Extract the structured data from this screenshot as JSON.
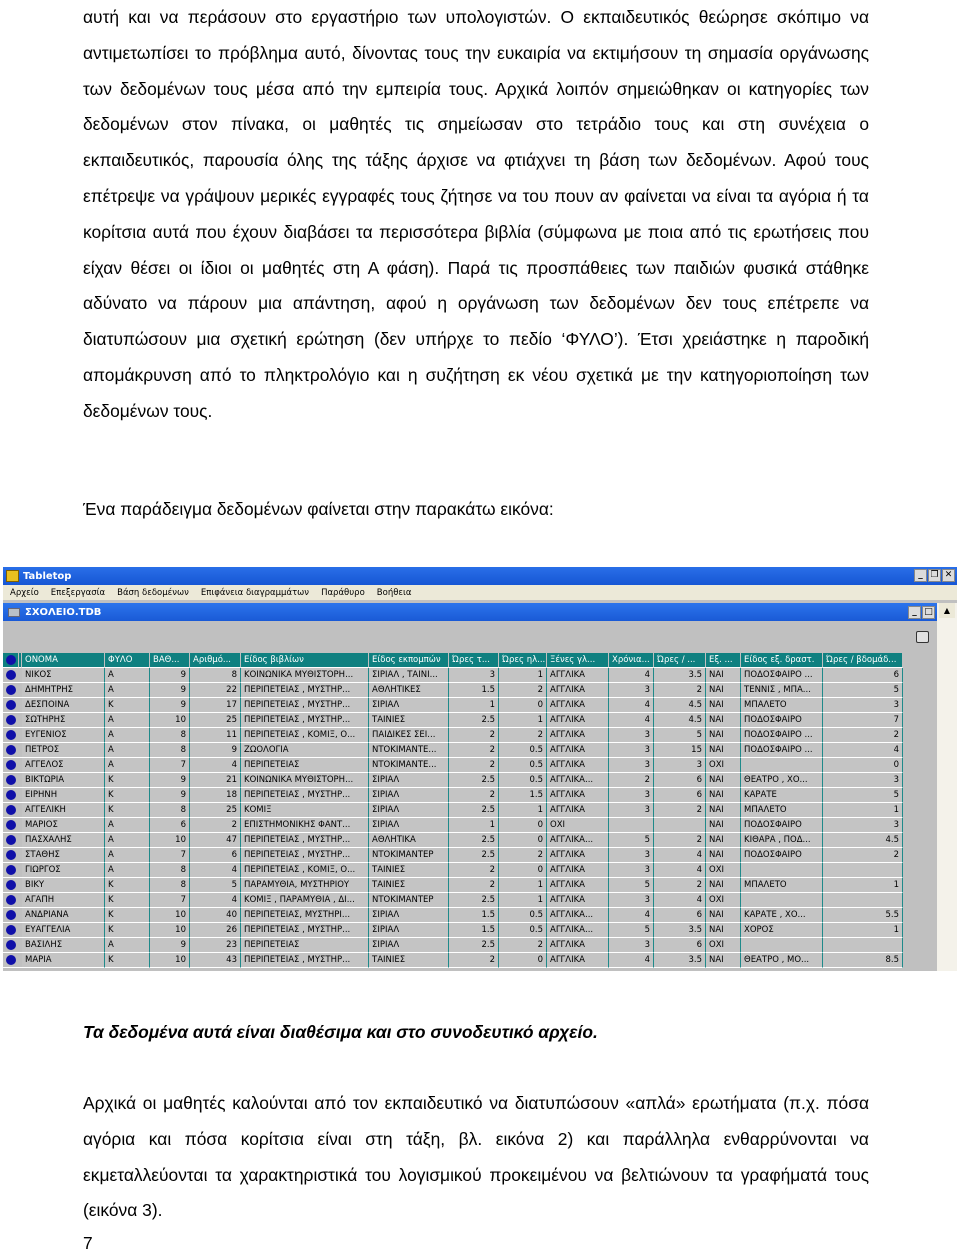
{
  "doc": {
    "paragraph1": "αυτή και να περάσουν στο εργαστήριο των υπολογιστών. Ο εκπαιδευτικός θεώρησε σκόπιμο να αντιμετωπίσει το πρόβλημα αυτό, δίνοντας τους την ευκαιρία να εκτιμήσουν τη σημασία οργάνωσης των δεδομένων τους μέσα από την εμπειρία τους. Αρχικά λοιπόν σημειώθηκαν οι κατηγορίες των δεδομένων στον πίνακα, οι μαθητές τις σημείωσαν στο τετράδιο τους και στη συνέχεια ο εκπαιδευτικός, παρουσία όλης της τάξης άρχισε να φτιάχνει τη βάση των δεδομένων. Αφού τους επέτρεψε να γράψουν μερικές εγγραφές τους ζήτησε να του πουν αν φαίνεται να είναι τα αγόρια ή τα κορίτσια αυτά που έχουν διαβάσει τα περισσότερα βιβλία (σύμφωνα με ποια από τις ερωτήσεις που είχαν θέσει οι ίδιοι οι μαθητές στη Α φάση). Παρά τις προσπάθειες των παιδιών φυσικά στάθηκε αδύνατο να πάρουν μια απάντηση, αφού η οργάνωση των δεδομένων δεν τους επέτρεπε να διατυπώσουν μια σχετική ερώτηση (δεν υπήρχε το πεδίο ‘ΦΥΛΟ’). Έτσι χρειάστηκε η παροδική απομάκρυνση από το πληκτρολόγιο και η συζήτηση εκ νέου σχετικά με την κατηγοριοποίηση των δεδομένων τους.",
    "caption_intro": "Ένα παράδειγμα δεδομένων φαίνεται στην παρακάτω εικόνα:",
    "italic_note": "Τα δεδομένα αυτά είναι διαθέσιμα και στο συνοδευτικό αρχείο.",
    "paragraph2": "Αρχικά οι μαθητές καλούνται από τον εκπαιδευτικό να διατυπώσουν «απλά» ερωτήματα (π.χ. πόσα αγόρια και πόσα κορίτσια είναι στη τάξη, βλ. εικόνα 2) και παράλληλα ενθαρρύνονται να εκμεταλλεύονται τα χαρακτηριστικά του λογισμικού προκειμένου να βελτιώνουν τα γραφήματά τους (εικόνα 3).",
    "page_number": "7"
  },
  "app": {
    "title": "Tabletop",
    "window_buttons": {
      "minimize": "_",
      "restore": "❐",
      "close": "✕"
    },
    "menu": [
      "Αρχείο",
      "Επεξεργασία",
      "Βάση δεδομένων",
      "Επιφάνεια διαγραμμάτων",
      "Παράθυρο",
      "Βοήθεια"
    ],
    "document_title": "ΣΧΟΛΕΙΟ.TDB",
    "doc_buttons": {
      "minimize": "_",
      "maximize": "□"
    },
    "scroll_up": "▲",
    "columns": [
      "ΟΝΟΜΑ",
      "ΦΥΛΟ",
      "ΒΑΘ...",
      "Αριθμό...",
      "Είδος βιβλίων",
      "Είδος εκπομπών",
      "Ώρες τ...",
      "Ώρες ηλ...",
      "Ξένες γλ...",
      "Χρόνια...",
      "Ώρες / ...",
      "Εξ. ...",
      "Είδος εξ. δραστ.",
      "Ώρες / βδομάδ..."
    ],
    "rows": [
      [
        "ΝΙΚΟΣ",
        "Α",
        "9",
        "8",
        "ΚΟΙΝΩΝΙΚΑ ΜΥΘΙΣΤΟΡΗ...",
        "ΣΙΡΙΑΛ , ΤΑΙΝΙ...",
        "3",
        "1",
        "ΑΓΓΛΙΚΑ",
        "4",
        "3.5",
        "ΝΑΙ",
        "ΠΟΔΟΣΦΑΙΡΟ ...",
        "6"
      ],
      [
        "ΔΗΜΗΤΡΗΣ",
        "Α",
        "9",
        "22",
        "ΠΕΡΙΠΕΤΕΙΑΣ , ΜΥΣΤΗΡ...",
        "ΑΘΛΗΤΙΚΕΣ",
        "1.5",
        "2",
        "ΑΓΓΛΙΚΑ",
        "3",
        "2",
        "ΝΑΙ",
        "ΤΕΝΝΙΣ , ΜΠΑ...",
        "5"
      ],
      [
        "ΔΕΣΠΟΙΝΑ",
        "Κ",
        "9",
        "17",
        "ΠΕΡΙΠΕΤΕΙΑΣ , ΜΥΣΤΗΡ...",
        "ΣΙΡΙΑΛ",
        "1",
        "0",
        "ΑΓΓΛΙΚΑ",
        "4",
        "4.5",
        "ΝΑΙ",
        "ΜΠΑΛΕΤΟ",
        "3"
      ],
      [
        "ΣΩΤΗΡΗΣ",
        "Α",
        "10",
        "25",
        "ΠΕΡΙΠΕΤΕΙΑΣ , ΜΥΣΤΗΡ...",
        "ΤΑΙΝΙΕΣ",
        "2.5",
        "1",
        "ΑΓΓΛΙΚΑ",
        "4",
        "4.5",
        "ΝΑΙ",
        "ΠΟΔΟΣΦΑΙΡΟ",
        "7"
      ],
      [
        "ΕΥΓΕΝΙΟΣ",
        "Α",
        "8",
        "11",
        "ΠΕΡΙΠΕΤΕΙΑΣ , ΚΟΜΙΞ, Ο...",
        "ΠΑΙΔΙΚΕΣ ΣΕΙ...",
        "2",
        "2",
        "ΑΓΓΛΙΚΑ",
        "3",
        "5",
        "ΝΑΙ",
        "ΠΟΔΟΣΦΑΙΡΟ ...",
        "2"
      ],
      [
        "ΠΕΤΡΟΣ",
        "Α",
        "8",
        "9",
        "ΖΩΟΛΟΓΙΑ",
        "ΝΤΟΚΙΜΑΝΤΕ...",
        "2",
        "0.5",
        "ΑΓΓΛΙΚΑ",
        "3",
        "15",
        "ΝΑΙ",
        "ΠΟΔΟΣΦΑΙΡΟ ...",
        "4"
      ],
      [
        "ΑΓΓΕΛΟΣ",
        "Α",
        "7",
        "4",
        "ΠΕΡΙΠΕΤΕΙΑΣ",
        "ΝΤΟΚΙΜΑΝΤΕ...",
        "2",
        "0.5",
        "ΑΓΓΛΙΚΑ",
        "3",
        "3",
        "ΟΧΙ",
        "",
        "0"
      ],
      [
        "ΒΙΚΤΩΡΙΑ",
        "Κ",
        "9",
        "21",
        "ΚΟΙΝΩΝΙΚΑ ΜΥΘΙΣΤΟΡΗ...",
        "ΣΙΡΙΑΛ",
        "2.5",
        "0.5",
        "ΑΓΓΛΙΚΑ...",
        "2",
        "6",
        "ΝΑΙ",
        "ΘΕΑΤΡΟ , ΧΟ...",
        "3"
      ],
      [
        "ΕΙΡΗΝΗ",
        "Κ",
        "9",
        "18",
        "ΠΕΡΙΠΕΤΕΙΑΣ , ΜΥΣΤΗΡ...",
        "ΣΙΡΙΑΛ",
        "2",
        "1.5",
        "ΑΓΓΛΙΚΑ",
        "3",
        "6",
        "ΝΑΙ",
        "ΚΑΡΑΤΕ",
        "5"
      ],
      [
        "ΑΓΓΕΛΙΚΗ",
        "Κ",
        "8",
        "25",
        "ΚΟΜΙΞ",
        "ΣΙΡΙΑΛ",
        "2.5",
        "1",
        "ΑΓΓΛΙΚΑ",
        "3",
        "2",
        "ΝΑΙ",
        "ΜΠΑΛΕΤΟ",
        "1"
      ],
      [
        "ΜΑΡΙΟΣ",
        "Α",
        "6",
        "2",
        "ΕΠΙΣΤΗΜΟΝΙΚΗΣ ΦΑΝΤ...",
        "ΣΙΡΙΑΛ",
        "1",
        "0",
        "ΟΧΙ",
        "",
        "",
        "ΝΑΙ",
        "ΠΟΔΟΣΦΑΙΡΟ",
        "3"
      ],
      [
        "ΠΑΣΧΑΛΗΣ",
        "Α",
        "10",
        "47",
        "ΠΕΡΙΠΕΤΕΙΑΣ , ΜΥΣΤΗΡ...",
        "ΑΘΛΗΤΙΚΑ",
        "2.5",
        "0",
        "ΑΓΓΛΙΚΑ...",
        "5",
        "2",
        "ΝΑΙ",
        "ΚΙΘΑΡΑ , ΠΟΔ...",
        "4.5"
      ],
      [
        "ΣΤΑΘΗΣ",
        "Α",
        "7",
        "6",
        "ΠΕΡΙΠΕΤΕΙΑΣ , ΜΥΣΤΗΡ...",
        "ΝΤΟΚΙΜΑΝΤΕΡ",
        "2.5",
        "2",
        "ΑΓΓΛΙΚΑ",
        "3",
        "4",
        "ΝΑΙ",
        "ΠΟΔΟΣΦΑΙΡΟ",
        "2"
      ],
      [
        "ΓΙΩΡΓΟΣ",
        "Α",
        "8",
        "4",
        "ΠΕΡΙΠΕΤΕΙΑΣ , ΚΟΜΙΞ, Ο...",
        "ΤΑΙΝΙΕΣ",
        "2",
        "0",
        "ΑΓΓΛΙΚΑ",
        "3",
        "4",
        "ΟΧΙ",
        "",
        ""
      ],
      [
        "ΒΙΚΥ",
        "Κ",
        "8",
        "5",
        "ΠΑΡΑΜΥΘΙΑ, ΜΥΣΤΗΡΙΟΥ",
        "ΤΑΙΝΙΕΣ",
        "2",
        "1",
        "ΑΓΓΛΙΚΑ",
        "5",
        "2",
        "ΝΑΙ",
        "ΜΠΑΛΕΤΟ",
        "1"
      ],
      [
        "ΑΓΑΠΗ",
        "Κ",
        "7",
        "4",
        "ΚΟΜΙΞ , ΠΑΡΑΜΥΘΙΑ , ΔΙ...",
        "ΝΤΟΚΙΜΑΝΤΕΡ",
        "2.5",
        "1",
        "ΑΓΓΛΙΚΑ",
        "3",
        "4",
        "ΟΧΙ",
        "",
        ""
      ],
      [
        "ΑΝΔΡΙΑΝΑ",
        "Κ",
        "10",
        "40",
        "ΠΕΡΙΠΕΤΕΙΑΣ, ΜΥΣΤΗΡΙ...",
        "ΣΙΡΙΑΛ",
        "1.5",
        "0.5",
        "ΑΓΓΛΙΚΑ...",
        "4",
        "6",
        "ΝΑΙ",
        "ΚΑΡΑΤΕ , ΧΟ...",
        "5.5"
      ],
      [
        "ΕΥΑΓΓΕΛΙΑ",
        "Κ",
        "10",
        "26",
        "ΠΕΡΙΠΕΤΕΙΑΣ , ΜΥΣΤΗΡ...",
        "ΣΙΡΙΑΛ",
        "1.5",
        "0.5",
        "ΑΓΓΛΙΚΑ...",
        "5",
        "3.5",
        "ΝΑΙ",
        "ΧΟΡΟΣ",
        "1"
      ],
      [
        "ΒΑΣΙΛΗΣ",
        "Α",
        "9",
        "23",
        "ΠΕΡΙΠΕΤΕΙΑΣ",
        "ΣΙΡΙΑΛ",
        "2.5",
        "2",
        "ΑΓΓΛΙΚΑ",
        "3",
        "6",
        "ΟΧΙ",
        "",
        ""
      ],
      [
        "ΜΑΡΙΑ",
        "Κ",
        "10",
        "43",
        "ΠΕΡΙΠΕΤΕΙΑΣ , ΜΥΣΤΗΡ...",
        "ΤΑΙΝΙΕΣ",
        "2",
        "0",
        "ΑΓΓΛΙΚΑ",
        "4",
        "3.5",
        "ΝΑΙ",
        "ΘΕΑΤΡΟ , ΜΟ...",
        "8.5"
      ]
    ],
    "colors": {
      "title_bar": "#1a5ad6",
      "header": "#0f8080",
      "row_bg": "#c4c4c4",
      "marker": "#1010a8"
    }
  }
}
